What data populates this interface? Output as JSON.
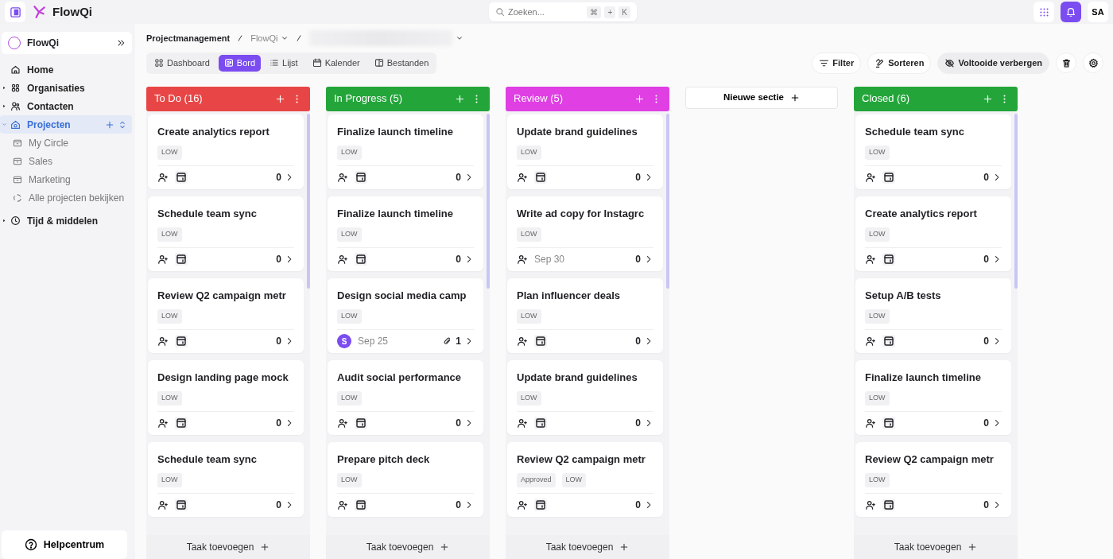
{
  "topbar": {
    "app_name": "FlowQi",
    "search": {
      "placeholder": "Zoeken...",
      "shortcut": [
        "⌘",
        "+",
        "K"
      ]
    },
    "user_initials": "SA"
  },
  "sidebar": {
    "workspace": "FlowQi",
    "items": [
      {
        "label": "Home",
        "kind": "link",
        "selected": false
      },
      {
        "label": "Organisaties",
        "kind": "group",
        "expanded": false,
        "selected": false
      },
      {
        "label": "Contacten",
        "kind": "group",
        "expanded": false,
        "selected": false
      },
      {
        "label": "Projecten",
        "kind": "group",
        "expanded": true,
        "selected": true,
        "children": [
          {
            "label": "My Circle",
            "kind": "folder"
          },
          {
            "label": "Sales",
            "kind": "folder"
          },
          {
            "label": "Marketing",
            "kind": "folder"
          },
          {
            "label": "Alle projecten bekijken",
            "kind": "action"
          }
        ]
      },
      {
        "label": "Tijd & middelen",
        "kind": "group",
        "expanded": false,
        "selected": false
      }
    ],
    "help": "Helpcentrum"
  },
  "breadcrumb": [
    {
      "label": "Projectmanagement",
      "dropdown": false
    },
    {
      "label": "FlowQi",
      "dropdown": true
    },
    {
      "dropdown": true,
      "blurred": true
    }
  ],
  "view_tabs": [
    {
      "label": "Dashboard",
      "selected": false
    },
    {
      "label": "Bord",
      "selected": true
    },
    {
      "label": "Lijst",
      "selected": false
    },
    {
      "label": "Kalender",
      "selected": false
    },
    {
      "label": "Bestanden",
      "selected": false
    }
  ],
  "toolbar": [
    {
      "label": "Filter",
      "on": false
    },
    {
      "label": "Sorteren",
      "on": false
    },
    {
      "label": "Voltooide verbergen",
      "on": true
    }
  ],
  "columns": [
    {
      "kind": "list",
      "title": "To Do (16)",
      "color": "#e84646",
      "add_task": "Taak toevoegen",
      "cards": [
        {
          "title": "Create analytics report",
          "tags": [
            "LOW"
          ],
          "count": "0",
          "attachment": false
        },
        {
          "title": "Schedule team sync",
          "tags": [
            "LOW"
          ],
          "count": "0",
          "attachment": false
        },
        {
          "title": "Review Q2 campaign metr",
          "tags": [
            "LOW"
          ],
          "count": "0",
          "attachment": false
        },
        {
          "title": "Design landing page mock",
          "tags": [
            "LOW"
          ],
          "count": "0",
          "attachment": false
        },
        {
          "title": "Schedule team sync",
          "tags": [
            "LOW"
          ],
          "count": "0",
          "attachment": false
        }
      ]
    },
    {
      "kind": "list",
      "title": "In Progress (5)",
      "color": "#23a53a",
      "add_task": "Taak toevoegen",
      "cards": [
        {
          "title": "Finalize launch timeline",
          "tags": [
            "LOW"
          ],
          "count": "0",
          "attachment": false
        },
        {
          "title": "Finalize launch timeline",
          "tags": [
            "LOW"
          ],
          "count": "0",
          "attachment": false
        },
        {
          "title": "Design social media camp",
          "tags": [
            "LOW"
          ],
          "assignee": "S",
          "date": "Sep 25",
          "count": "1",
          "attachment": true
        },
        {
          "title": "Audit social performance",
          "tags": [
            "LOW"
          ],
          "count": "0",
          "attachment": false
        },
        {
          "title": "Prepare pitch deck",
          "tags": [
            "LOW"
          ],
          "count": "0",
          "attachment": false
        }
      ]
    },
    {
      "kind": "list",
      "title": "Review (5)",
      "color": "#df3fe3",
      "add_task": "Taak toevoegen",
      "cards": [
        {
          "title": "Update brand guidelines",
          "tags": [
            "LOW"
          ],
          "count": "0",
          "attachment": false
        },
        {
          "title": "Write ad copy for Instagrc",
          "tags": [
            "LOW"
          ],
          "date": "Sep 30",
          "count": "0",
          "attachment": false
        },
        {
          "title": "Plan influencer deals",
          "tags": [
            "LOW"
          ],
          "count": "0",
          "attachment": false
        },
        {
          "title": "Update brand guidelines",
          "tags": [
            "LOW"
          ],
          "count": "0",
          "attachment": false
        },
        {
          "title": "Review Q2 campaign metr",
          "tags": [
            "Approved",
            "LOW"
          ],
          "count": "0",
          "attachment": false
        }
      ]
    },
    {
      "kind": "new-section",
      "title": "Nieuwe sectie"
    },
    {
      "kind": "list",
      "title": "Closed (6)",
      "color": "#23a53a",
      "add_task": "Taak toevoegen",
      "cards": [
        {
          "title": "Schedule team sync",
          "tags": [
            "LOW"
          ],
          "count": "0",
          "attachment": false
        },
        {
          "title": "Create analytics report",
          "tags": [
            "LOW"
          ],
          "count": "0",
          "attachment": false
        },
        {
          "title": "Setup A/B tests",
          "tags": [
            "LOW"
          ],
          "count": "0",
          "attachment": false
        },
        {
          "title": "Finalize launch timeline",
          "tags": [
            "LOW"
          ],
          "count": "0",
          "attachment": false
        },
        {
          "title": "Review Q2 campaign metr",
          "tags": [
            "LOW"
          ],
          "count": "0",
          "attachment": false
        }
      ]
    }
  ]
}
